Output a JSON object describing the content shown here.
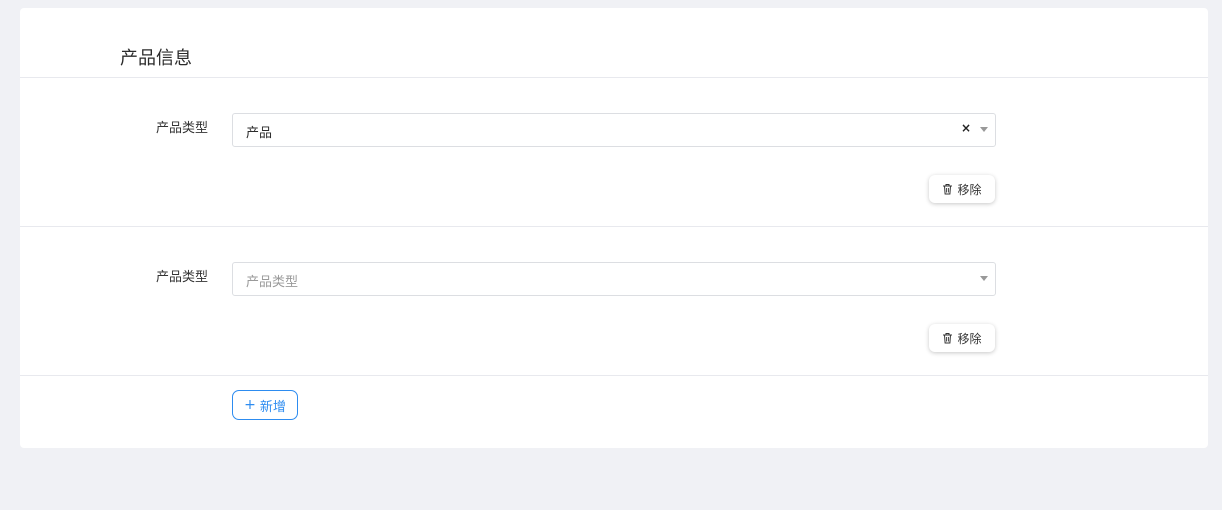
{
  "section": {
    "title": "产品信息"
  },
  "rows": [
    {
      "label": "产品类型",
      "select_value": "产品",
      "clear_glyph": "×",
      "remove_label": "移除"
    },
    {
      "label": "产品类型",
      "placeholder": "产品类型",
      "remove_label": "移除"
    }
  ],
  "add_button": {
    "glyph": "+",
    "label": "新增"
  },
  "colors": {
    "page_background": "#f0f1f5",
    "card_background": "#ffffff",
    "accent": "#2d8cf0",
    "divider": "#e8e9ee"
  },
  "icons": {
    "clear": "close-icon",
    "dropdown": "caret-down-icon",
    "remove": "trash-icon",
    "add": "plus-icon"
  }
}
